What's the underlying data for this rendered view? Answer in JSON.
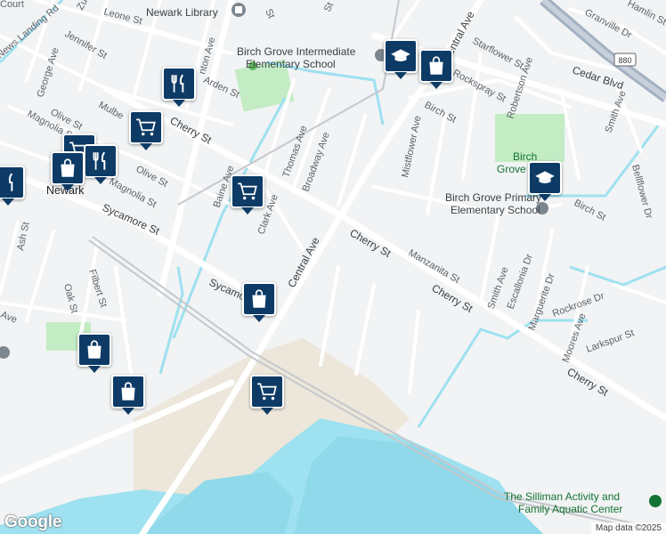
{
  "labels": {
    "leone_st": "Leone St",
    "newark_library": "Newark Library",
    "birch_grove_intermediate_1": "Birch Grove Intermediate",
    "birch_grove_intermediate_2": "Elementary School",
    "news_landing": "News Landing Rd",
    "jennifer_st": "Jennifer St",
    "george_ave": "George Ave",
    "arden_st": "Arden St",
    "olive_st_top": "Olive St",
    "olive_st": "Olive St",
    "magnolia_st_left": "Magnolia St",
    "magnolia_st": "Magnolia St",
    "mulberry": "Mulbe",
    "cherry_st_top": "Cherry St",
    "thomas_ave": "Thomas Ave",
    "broadway_ave": "Broadway Ave",
    "clark_ave": "Clark Ave",
    "baine_ave": "Baine Ave",
    "newark": "Newark",
    "sycamore_st": "Sycamore St",
    "sycamo": "Sycamo",
    "central_ave_mid": "Central Ave",
    "central_ave_top": "Central Ave",
    "ash_st": "Ash St",
    "oak_st": "Oak St",
    "filbert_st": "Filbert St",
    "ave_left": "Ave",
    "cherry_st_mid": "Cherry St",
    "cherry_st_right": "Cherry St",
    "cherry_st_bottom": "Cherry St",
    "manzanita_st": "Manzanita St",
    "mistflower_ave": "Mistflower Ave",
    "birch_st_top": "Birch St",
    "birch_st_right": "Birch St",
    "birch_grove_park": "Birch",
    "birch_grove_park2": "Grove",
    "birch_grove_primary_1": "Birch Grove Primary",
    "birch_grove_primary_2": "Elementary School",
    "starflower_st": "Starflower St",
    "rockspray_st": "Rockspray St",
    "robertson_ave": "Robertson Ave",
    "cedar_blvd": "Cedar Blvd",
    "granville_dr": "Granville Dr",
    "hamlin_st": "Hamlin St",
    "smith_ave_top": "Smith Ave",
    "smith_ave": "Smith Ave",
    "escallonia_dr": "Escallonia Dr",
    "marguerite_dr": "Marguerite Dr",
    "rockrose_dr": "Rockrose Dr",
    "moores_ave": "Moores Ave",
    "larkspur_st": "Larkspur St",
    "bellflower_dr": "Bellflower Dr",
    "highway_880": "880",
    "silliman_1": "The Silliman Activity and",
    "silliman_2": "Family Aquatic Center",
    "court": "Court",
    "zu": "Zu",
    "ston_ave": "nton Ave",
    "st_top1": "St",
    "st_top2": "St"
  },
  "pins": [
    {
      "name": "school-pin-intermediate",
      "type": "school"
    },
    {
      "name": "shopping-pin-top",
      "type": "shopping"
    },
    {
      "name": "restaurant-pin-arden",
      "type": "restaurant"
    },
    {
      "name": "grocery-pin-cherry",
      "type": "grocery"
    },
    {
      "name": "shopping-pin-newark",
      "type": "shopping"
    },
    {
      "name": "grocery-pin-baine",
      "type": "grocery"
    },
    {
      "name": "school-pin-primary",
      "type": "school"
    },
    {
      "name": "shopping-pin-sycamore",
      "type": "shopping"
    },
    {
      "name": "shopping-pin-left",
      "type": "shopping"
    },
    {
      "name": "shopping-pin-bottom",
      "type": "shopping"
    },
    {
      "name": "grocery-pin-bottom",
      "type": "grocery"
    }
  ],
  "attribution": {
    "logo": "Google",
    "map_data": "Map data ©2025"
  },
  "colors": {
    "water": "#9ee1f0",
    "park": "#c3ecc4",
    "land": "#f1f3f4",
    "road": "#ffffff",
    "highway": "#a3b1c2",
    "pin": "#0d3b66",
    "sand": "#ece7da"
  }
}
